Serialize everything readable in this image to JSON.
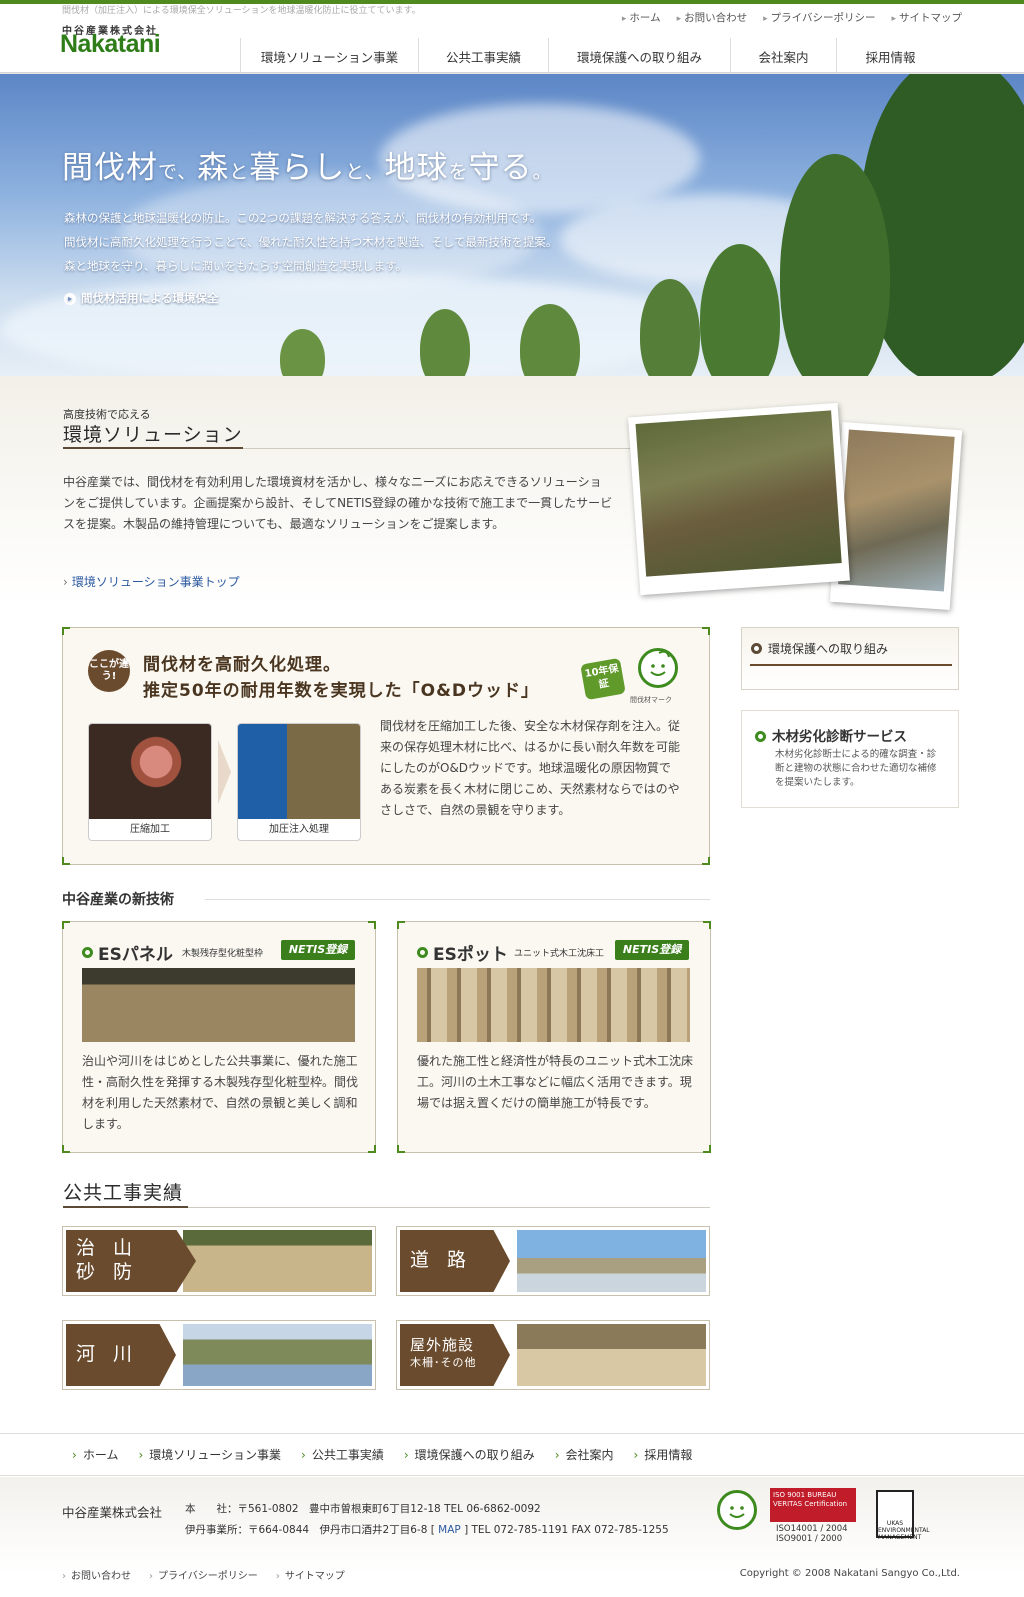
{
  "header": {
    "tagline": "間伐材（加圧注入）による環境保全ソリューションを地球温暖化防止に役立てています。",
    "company_ja": "中谷産業株式会社",
    "company_en": "Nakatani",
    "util_nav": [
      "ホーム",
      "お問い合わせ",
      "プライバシーポリシー",
      "サイトマップ"
    ],
    "global_nav": [
      "環境ソリューション事業",
      "公共工事実績",
      "環境保護への取り組み",
      "会社案内",
      "採用情報"
    ]
  },
  "hero": {
    "title_parts": [
      "間伐材",
      "で、",
      "森",
      "と",
      "暮らし",
      "と、",
      "地球",
      "を",
      "守る",
      "。"
    ],
    "lines": [
      "森林の保護と地球温暖化の防止。この2つの課題を解決する答えが、間伐材の有効利用です。",
      "間伐材に高耐久化処理を行うことで、優れた耐久性を持つ木材を製造、そして最新技術を提案。",
      "森と地球を守り、暮らしに潤いをもたらす空間創造を実現します。"
    ],
    "link": "間伐材活用による環境保全"
  },
  "solutions": {
    "kicker": "高度技術で応える",
    "title": "環境ソリューション",
    "body": "中谷産業では、間伐材を有効利用した環境資材を活かし、様々なニーズにお応えできるソリューションをご提供しています。企画提案から設計、そしてNETIS登録の確かな技術で施工まで一貫したサービスを提案。木製品の維持管理についても、最適なソリューションをご提案します。",
    "link": "環境ソリューション事業トップ"
  },
  "od_wood": {
    "badge": "ここが違う!",
    "headline1": "間伐材を高耐久化処理。",
    "headline2": "推定50年の耐用年数を実現した「O&Dウッド」",
    "guarantee": "10年保証",
    "mark_label": "間伐材マーク",
    "photo1_caption": "圧縮加工",
    "photo2_caption": "加圧注入処理",
    "text": "間伐材を圧縮加工した後、安全な木材保存剤を注入。従来の保存処理木材に比べ、はるかに長い耐久年数を可能にしたのがO&Dウッドです。地球温暖化の原因物質である炭素を長く木材に閉じこめ、天然素材ならではのやさしさで、自然の景観を守ります。"
  },
  "sidebar": {
    "env_link": "環境保護への取り組み",
    "diag_title": "木材劣化診断サービス",
    "diag_text": "木材劣化診断士による的確な調査・診断と建物の状態に合わせた適切な補修を提案いたします。"
  },
  "new_tech": {
    "title": "中谷産業の新技術",
    "cards": [
      {
        "title": "ESパネル",
        "sub": "木製残存型化粧型枠",
        "badge": "NETIS登録",
        "text": "治山や河川をはじめとした公共事業に、優れた施工性・高耐久性を発揮する木製残存型化粧型枠。間伐材を利用した天然素材で、自然の景観と美しく調和します。"
      },
      {
        "title": "ESポット",
        "sub": "ユニット式木工沈床工",
        "badge": "NETIS登録",
        "text": "優れた施工性と経済性が特長のユニット式木工沈床工。河川の土木工事などに幅広く活用できます。現場では据え置くだけの簡単施工が特長です。"
      }
    ]
  },
  "public_works": {
    "title": "公共工事実績",
    "tiles": [
      {
        "line1": "治 山",
        "line2": "砂 防"
      },
      {
        "line1": "道 路",
        "line2": ""
      },
      {
        "line1": "河 川",
        "line2": ""
      },
      {
        "line1": "屋外施設",
        "line2": "木柵･その他"
      }
    ]
  },
  "footer": {
    "nav": [
      "ホーム",
      "環境ソリューション事業",
      "公共工事実績",
      "環境保護への取り組み",
      "会社案内",
      "採用情報"
    ],
    "company": "中谷産業株式会社",
    "addr1": "本　　社：〒561-0802　豊中市曽根東町6丁目12-18 TEL 06-6862-0092",
    "addr2_pre": "伊丹事業所：〒664-0844　伊丹市口酒井2丁目6-8 [",
    "addr2_map": " MAP ",
    "addr2_post": "] TEL 072-785-1191 FAX 072-785-1255",
    "cert_bv": "ISO 9001 BUREAU VERITAS Certification",
    "cert_iso1": "ISO14001 / 2004",
    "cert_iso2": "ISO9001 / 2000",
    "cert_ukas": "UKAS ENVIRONMENTAL MANAGEMENT",
    "bottom_nav": [
      "お問い合わせ",
      "プライバシーポリシー",
      "サイトマップ"
    ],
    "copyright": "Copyright © 2008 Nakatani Sangyo Co.,Ltd."
  },
  "colors": {
    "brand_green": "#2f7d18",
    "accent_brown": "#6b4b2e",
    "link_blue": "#2c5aa0"
  }
}
